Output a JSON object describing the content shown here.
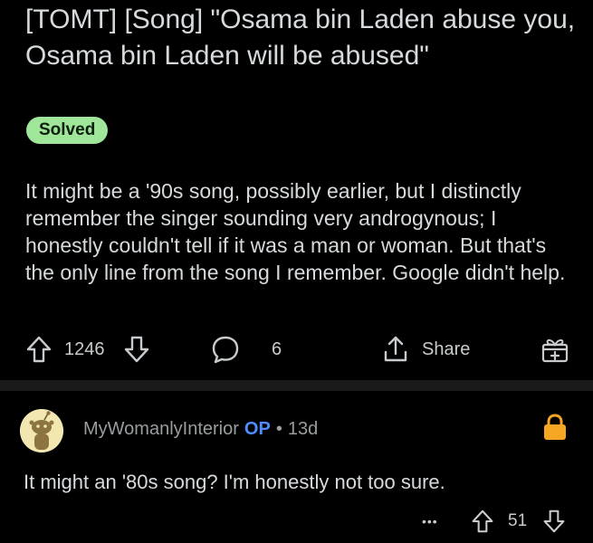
{
  "post": {
    "title": "[TOMT] [Song] \"Osama bin Laden abuse you, Osama bin Laden will be abused\"",
    "flair": "Solved",
    "flair_color": "#9fe59a",
    "body": "It might be a '90s song, possibly earlier, but I distinctly remember the singer sounding very androgynous; I honestly couldn't tell if it was a man or woman. But that's the only line from the song I remember. Google didn't help.",
    "votes": "1246",
    "comments_count": "6",
    "share_label": "Share",
    "icons": {
      "upvote": "upvote-arrow-icon",
      "downvote": "downvote-arrow-icon",
      "comment": "comment-bubble-icon",
      "share": "share-icon",
      "award": "gift-award-icon"
    }
  },
  "comment": {
    "username": "MyWomanlyInterior",
    "op_badge": "OP",
    "separator": "•",
    "age": "13d",
    "text": "It might an '80s song? I'm honestly not too sure.",
    "more": "•••",
    "votes": "51",
    "lock_color": "#f5a623",
    "op_color": "#4f8cff"
  }
}
